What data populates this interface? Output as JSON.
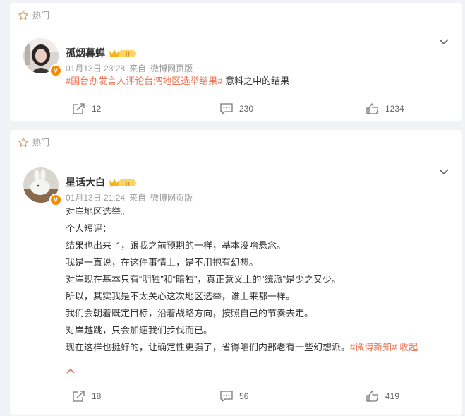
{
  "posts": [
    {
      "hot_label": "热门",
      "author": "孤烟暮蝉",
      "verified_mark": "V",
      "time": "01月13日 23:28",
      "source_prefix": "来自",
      "source": "微博网页版",
      "tag": "#国台办发言人评论台湾地区选举结果#",
      "text": " 意料之中的结果",
      "forward_count": "12",
      "comment_count": "230",
      "like_count": "1234"
    },
    {
      "hot_label": "热门",
      "author": "星话大白",
      "verified_mark": "V",
      "time": "01月13日 21:24",
      "source_prefix": "来自",
      "source": "微博网页版",
      "lines": [
        "对岸地区选举。",
        "个人短评：",
        "结果也出来了，跟我之前预期的一样，基本没啥悬念。",
        "我是一直说，在这件事情上，是不用抱有幻想。",
        "对岸现在基本只有“明独”和“暗独”，真正意义上的“统派”是少之又少。",
        "所以，其实我是不太关心这次地区选举，谁上来都一样。",
        "我们会朝着既定目标，沿着战略方向，按照自己的节奏去走。",
        "对岸越跳，只会加速我们步伐而已。"
      ],
      "last_line": "现在这样也挺好的，让确定性更强了，省得咱们内部老有一些幻想派。",
      "tag": "#微博新知#",
      "collapse_label": "收起",
      "forward_count": "18",
      "comment_count": "56",
      "like_count": "419"
    }
  ],
  "colors": {
    "accent": "#eb7350",
    "muted": "#9b9b9b",
    "background": "#f1f2f5"
  }
}
